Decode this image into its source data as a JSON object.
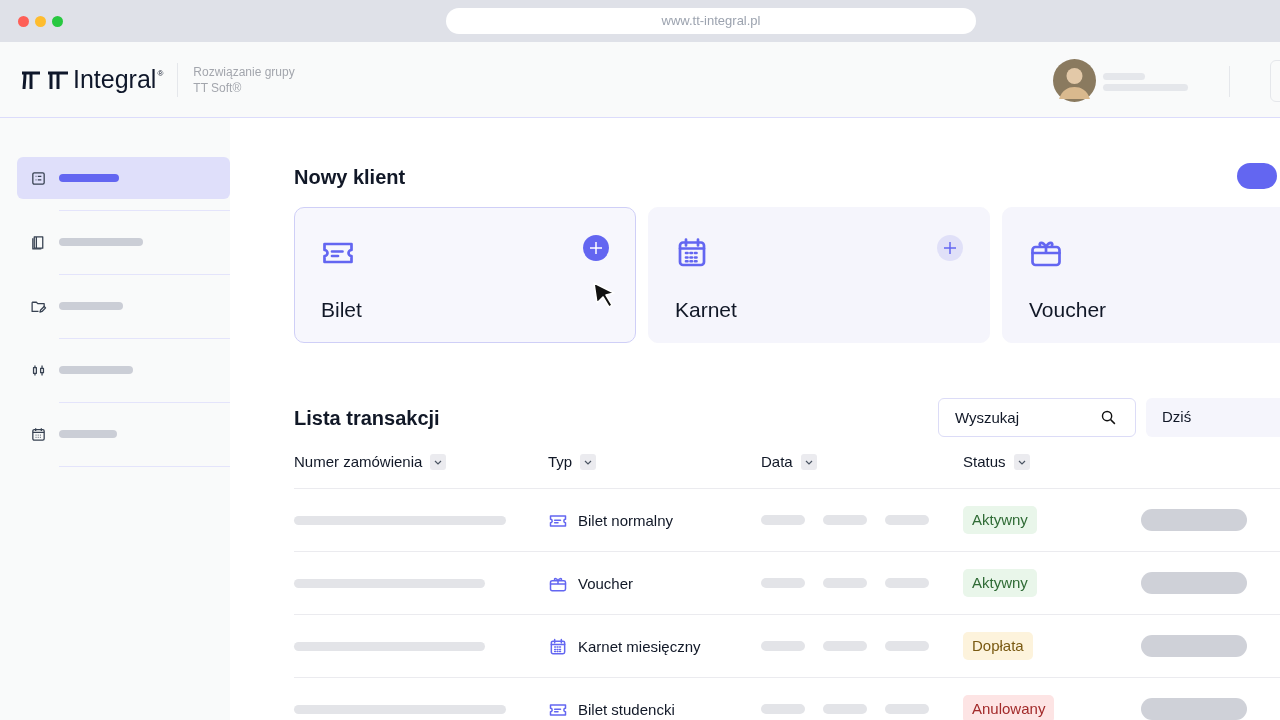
{
  "browser": {
    "url": "www.tt-integral.pl"
  },
  "header": {
    "logo": "Integral",
    "logo_mark": "®",
    "tagline_1": "Rozwiązanie grupy",
    "tagline_2": "TT Soft®"
  },
  "sidebar": {
    "items": [
      {
        "selected": true
      },
      {
        "selected": false
      },
      {
        "selected": false
      },
      {
        "selected": false
      },
      {
        "selected": false
      }
    ]
  },
  "new_client": {
    "title": "Nowy klient",
    "cards": [
      {
        "label": "Bilet",
        "kind": "ticket",
        "selected": true
      },
      {
        "label": "Karnet",
        "kind": "pass",
        "selected": false
      },
      {
        "label": "Voucher",
        "kind": "voucher",
        "selected": false
      }
    ]
  },
  "transactions": {
    "title": "Lista transakcji",
    "search": {
      "placeholder": "Wyszukaj"
    },
    "date_filter": "Dziś",
    "columns": [
      "Numer zamówienia",
      "Typ",
      "Data",
      "Status"
    ],
    "rows": [
      {
        "type": "Bilet normalny",
        "kind": "ticket",
        "status": "Aktywny",
        "color": "#e9f6ea"
      },
      {
        "type": "Voucher",
        "kind": "voucher",
        "status": "Aktywny",
        "color": "#e9f6ea"
      },
      {
        "type": "Karnet miesięczny",
        "kind": "pass",
        "status": "Dopłata",
        "color": "#fdf3dc"
      },
      {
        "type": "Bilet studencki",
        "kind": "ticket",
        "status": "Anulowany",
        "color": "#fde4e4"
      }
    ]
  }
}
